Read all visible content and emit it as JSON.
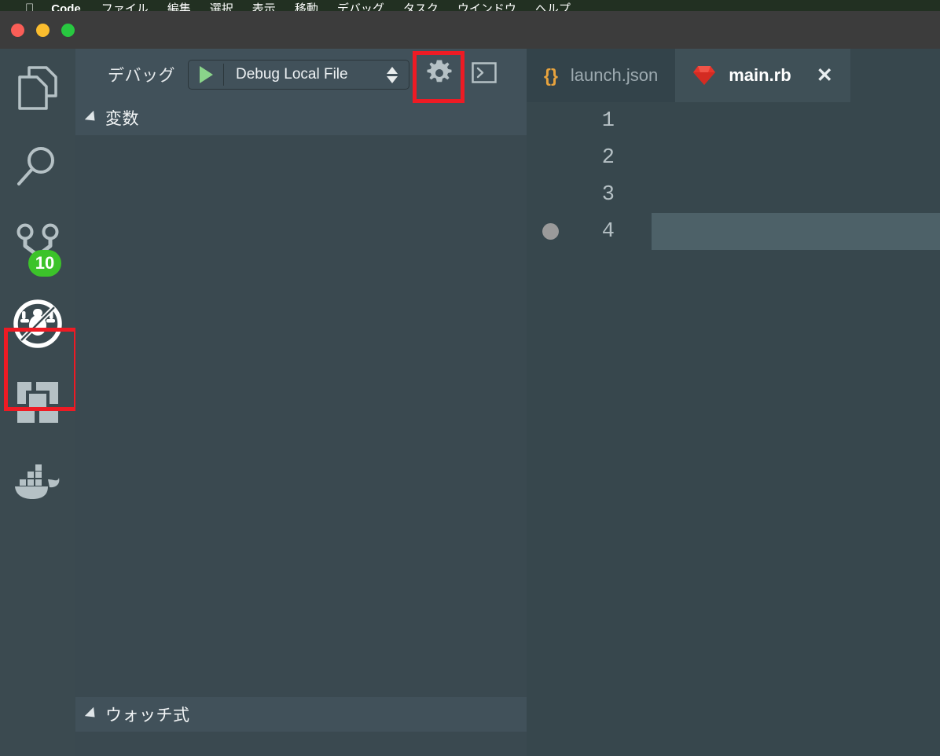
{
  "menubar": {
    "apple_icon": "apple-logo-icon",
    "items": [
      {
        "label": "Code",
        "bold": true
      },
      {
        "label": "ファイル"
      },
      {
        "label": "編集"
      },
      {
        "label": "選択"
      },
      {
        "label": "表示"
      },
      {
        "label": "移動"
      },
      {
        "label": "デバッグ"
      },
      {
        "label": "タスク"
      },
      {
        "label": "ウインドウ"
      },
      {
        "label": "ヘルプ"
      }
    ]
  },
  "titlebar": {
    "close_label": "close-window",
    "minimize_label": "minimize-window",
    "maximize_label": "maximize-window",
    "colors": {
      "close": "#fa5e57",
      "minimize": "#fbbd2e",
      "maximize": "#28c840"
    }
  },
  "activitybar": {
    "items": [
      {
        "name": "explorer",
        "icon": "files-icon",
        "badge": null,
        "highlighted": false
      },
      {
        "name": "search",
        "icon": "search-icon",
        "badge": null,
        "highlighted": false
      },
      {
        "name": "source-control",
        "icon": "source-control-branch-icon",
        "badge": "10",
        "highlighted": false
      },
      {
        "name": "debug",
        "icon": "no-debug-bug-icon",
        "badge": null,
        "highlighted": true
      },
      {
        "name": "extensions",
        "icon": "extensions-icon",
        "badge": null,
        "highlighted": false
      },
      {
        "name": "docker",
        "icon": "docker-whale-icon",
        "badge": null,
        "highlighted": false
      }
    ],
    "badge_color": "#3cc32a",
    "highlight_color": "#ee1b24"
  },
  "debug_panel": {
    "toolbar": {
      "title": "デバッグ",
      "start_icon": "play-triangle-icon",
      "configuration": "Debug Local File",
      "stepper_icon": "up-down-arrows-icon",
      "settings_icon": "gear-icon",
      "settings_highlighted": true,
      "terminal_icon": "open-debug-console-icon"
    },
    "sections": [
      {
        "title": "変数",
        "collapsed": false
      },
      {
        "title": "ウォッチ式",
        "collapsed": false
      }
    ]
  },
  "editor": {
    "tabs": [
      {
        "label": "launch.json",
        "icon": "json-braces-icon",
        "active": false,
        "closable": false
      },
      {
        "label": "main.rb",
        "icon": "ruby-gem-icon",
        "active": true,
        "closable": true,
        "close_glyph": "✕"
      }
    ],
    "line_numbers": [
      "1",
      "2",
      "3",
      "4"
    ],
    "breakpoint_line": "4",
    "breakpoint_icon": "breakpoint-dot-icon",
    "selected_line": "4"
  }
}
